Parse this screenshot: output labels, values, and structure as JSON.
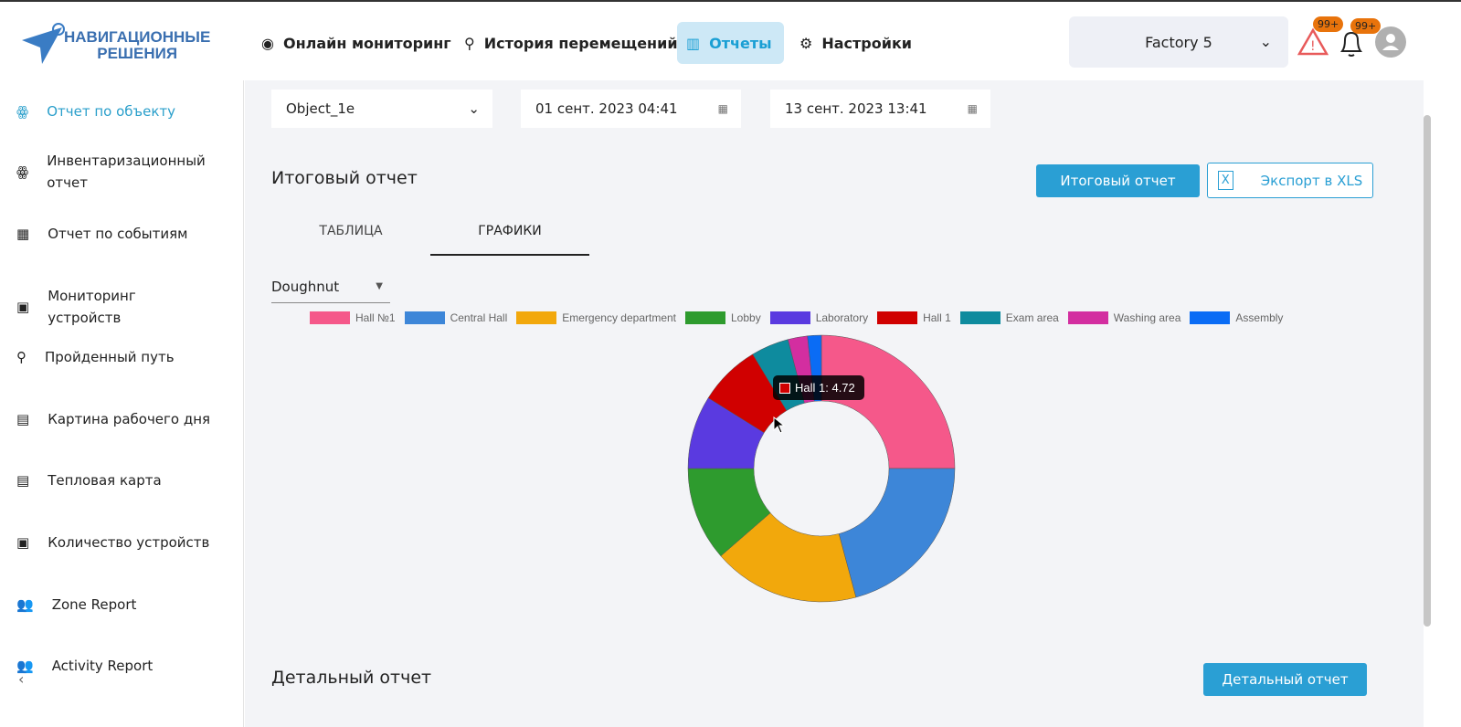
{
  "logo": {
    "line1": "НАВИГАЦИОННЫЕ",
    "line2": "РЕШЕНИЯ"
  },
  "nav": [
    {
      "label": "Онлайн мониторинг",
      "icon": "eye-icon"
    },
    {
      "label": "История перемещений",
      "icon": "route-icon"
    },
    {
      "label": "Отчеты",
      "icon": "chart-icon",
      "active": true
    },
    {
      "label": "Настройки",
      "icon": "gear-icon"
    }
  ],
  "factory": {
    "value": "Factory 5"
  },
  "alerts": {
    "warning_count": "99+",
    "notification_count": "99+"
  },
  "sidebar": {
    "items": [
      {
        "label": "Отчет по объекту",
        "active": true
      },
      {
        "label": "Инвентаризационный отчет"
      },
      {
        "label": "Отчет по событиям"
      },
      {
        "label": "Мониторинг устройств"
      },
      {
        "label": "Пройденный путь"
      },
      {
        "label": "Картина рабочего дня"
      },
      {
        "label": "Тепловая карта"
      },
      {
        "label": "Количество устройств"
      },
      {
        "label": "Zone Report"
      },
      {
        "label": "Activity Report"
      }
    ]
  },
  "filters": {
    "object_value": "Object_1e",
    "start_value": "01 сент. 2023 04:41",
    "end_value": "13 сент. 2023 13:41"
  },
  "summary": {
    "title": "Итоговый отчет",
    "button": "Итоговый отчет",
    "export": "Экспорт в XLS"
  },
  "tabs": [
    {
      "label": "ТАБЛИЦА"
    },
    {
      "label": "ГРАФИКИ",
      "active": true
    }
  ],
  "chart_select": {
    "value": "Doughnut"
  },
  "chart_data": {
    "type": "doughnut",
    "categories": [
      "Hall №1",
      "Central Hall",
      "Emergency department",
      "Lobby",
      "Laboratory",
      "Hall 1",
      "Exam area",
      "Washing area",
      "Assembly"
    ],
    "values": [
      15.73,
      13.11,
      11.19,
      7.17,
      5.59,
      4.72,
      2.88,
      1.49,
      1.05
    ],
    "colors": [
      "#f5588a",
      "#3d86d8",
      "#f2a80c",
      "#2e9b2e",
      "#5a3ae0",
      "#d00000",
      "#0e8b9e",
      "#d32ea0",
      "#0a6cf5"
    ],
    "legend": "top",
    "tooltip": {
      "label": "Hall 1: 4.72"
    }
  },
  "detail": {
    "title": "Детальный отчет",
    "button": "Детальный отчет"
  }
}
